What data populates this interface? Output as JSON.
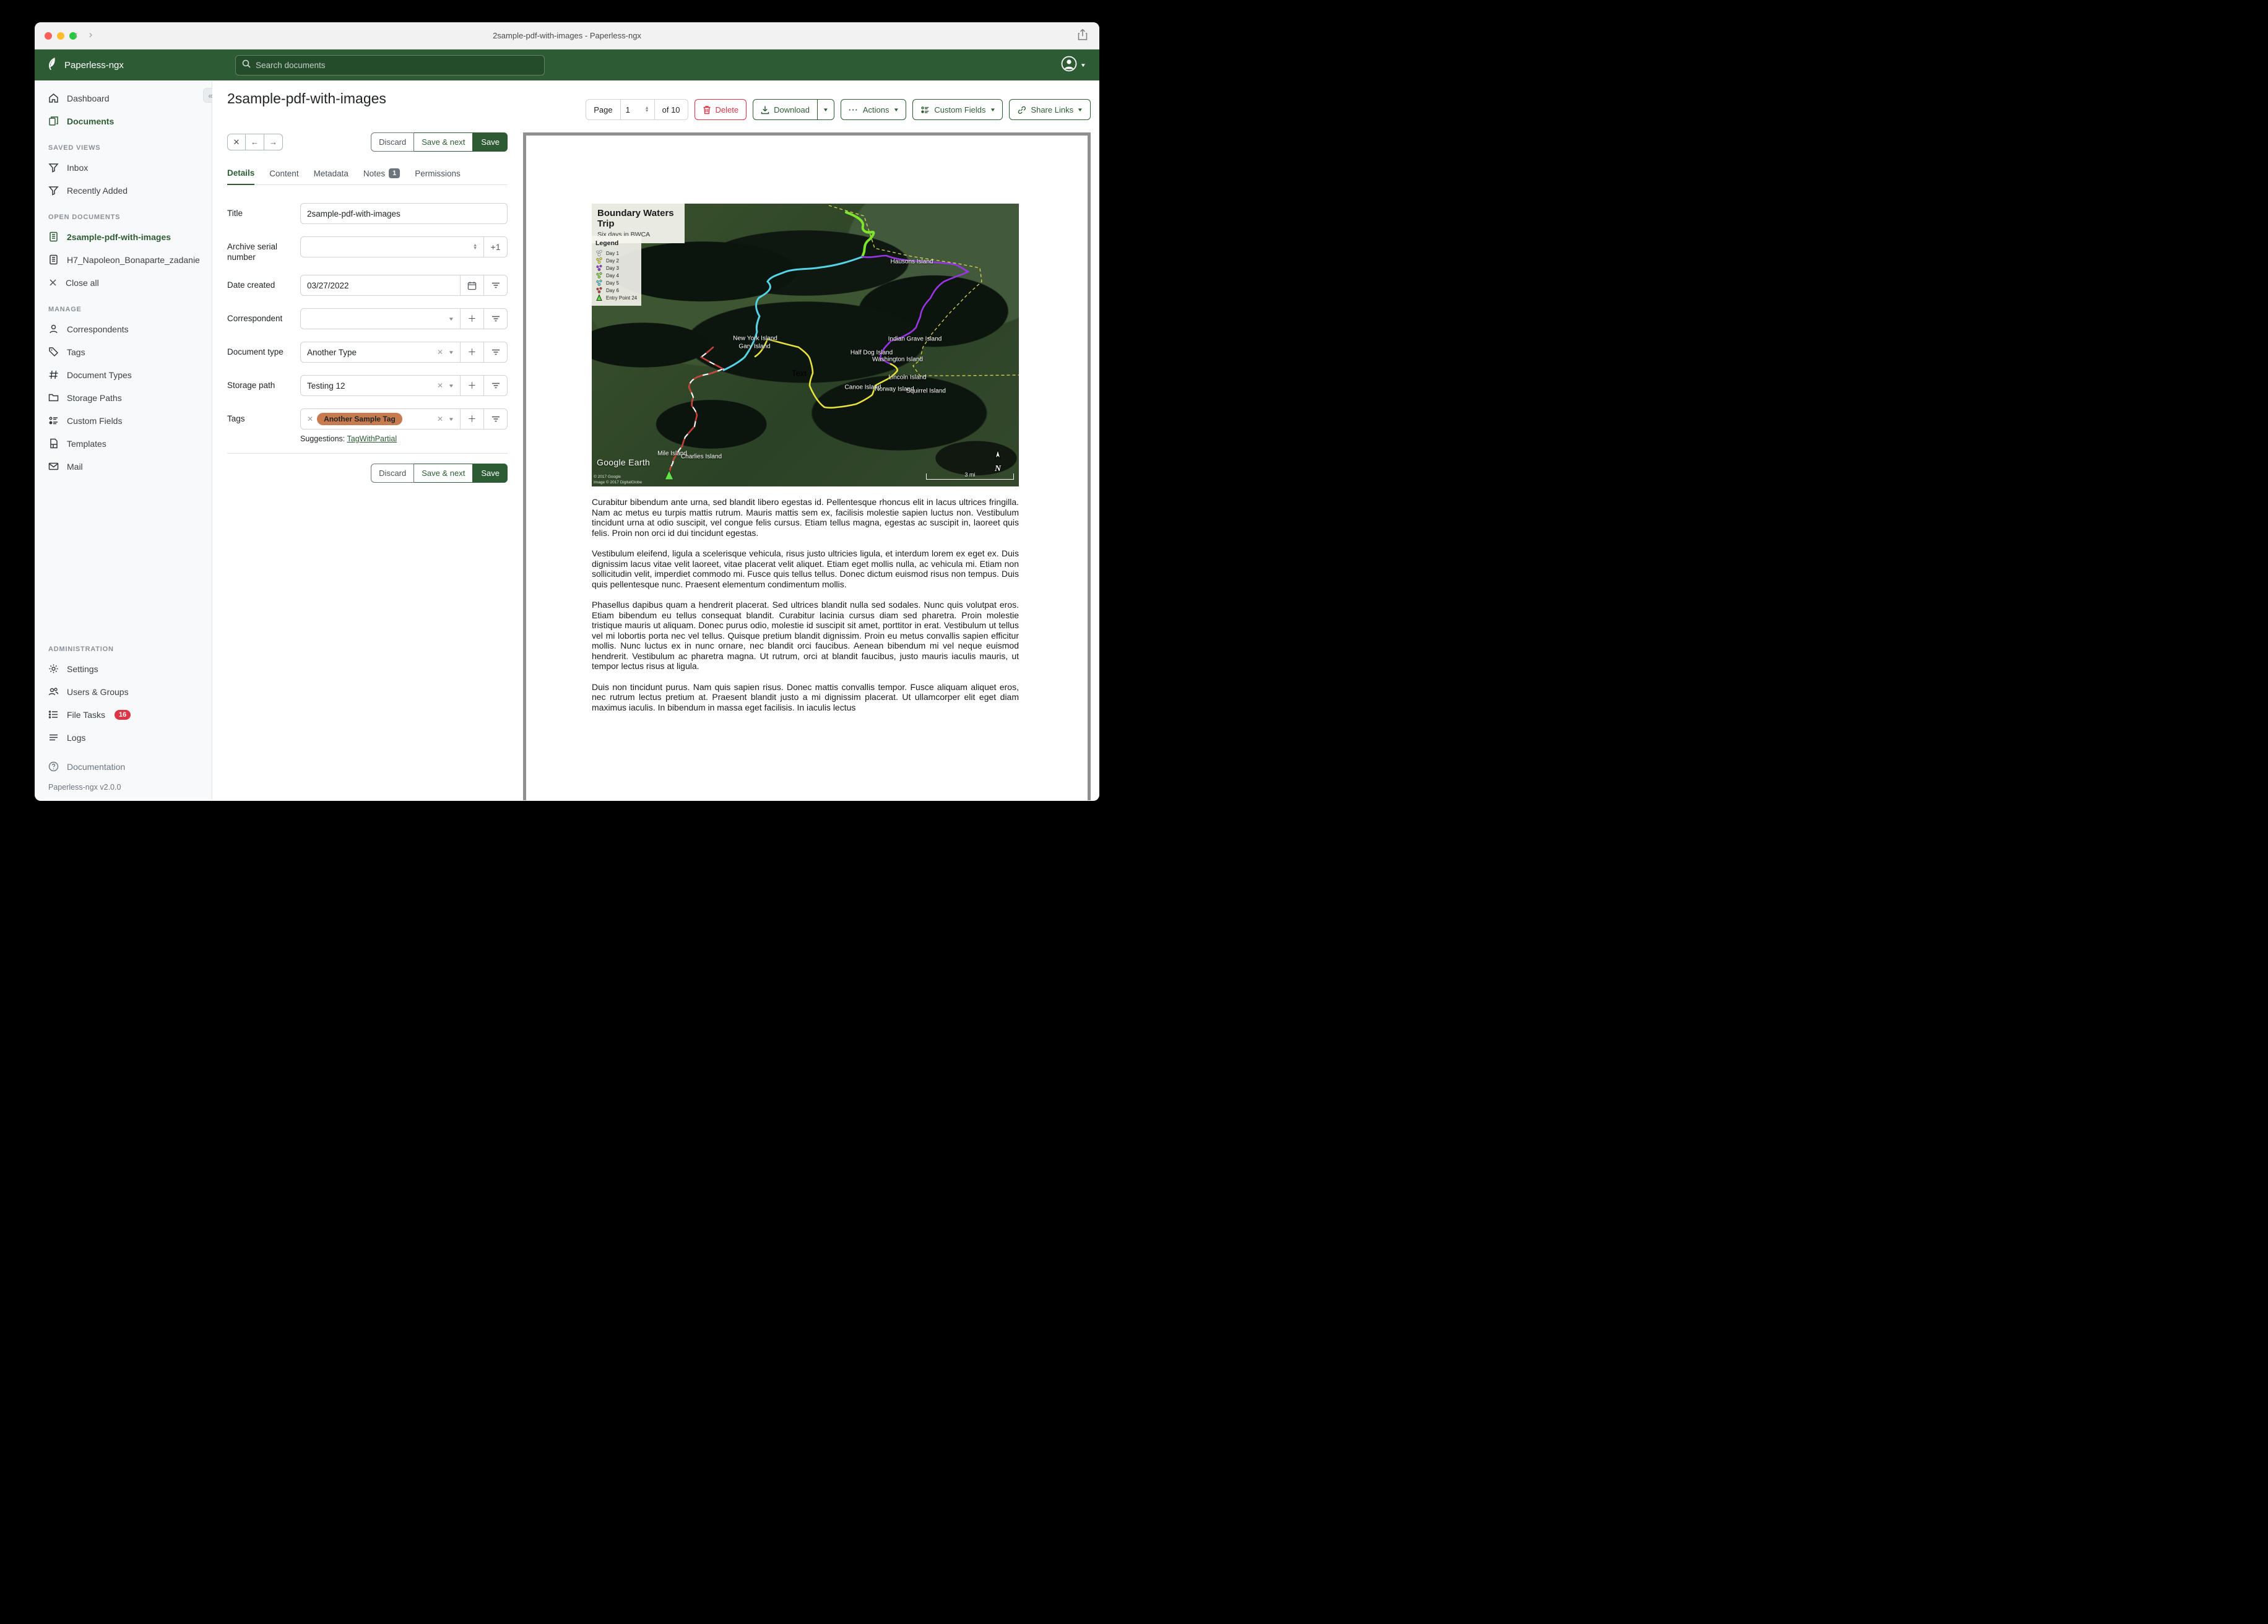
{
  "window": {
    "title": "2sample-pdf-with-images - Paperless-ngx"
  },
  "header": {
    "app_name": "Paperless-ngx",
    "search_placeholder": "Search documents"
  },
  "sidebar": {
    "collapse": "«",
    "items_top": [
      {
        "label": "Dashboard"
      },
      {
        "label": "Documents"
      }
    ],
    "sections": [
      {
        "title": "SAVED VIEWS",
        "items": [
          {
            "label": "Inbox"
          },
          {
            "label": "Recently Added"
          }
        ]
      },
      {
        "title": "OPEN DOCUMENTS",
        "items": [
          {
            "label": "2sample-pdf-with-images"
          },
          {
            "label": "H7_Napoleon_Bonaparte_zadanie"
          },
          {
            "label": "Close all"
          }
        ]
      },
      {
        "title": "MANAGE",
        "items": [
          {
            "label": "Correspondents"
          },
          {
            "label": "Tags"
          },
          {
            "label": "Document Types"
          },
          {
            "label": "Storage Paths"
          },
          {
            "label": "Custom Fields"
          },
          {
            "label": "Templates"
          },
          {
            "label": "Mail"
          }
        ]
      },
      {
        "title": "ADMINISTRATION",
        "items": [
          {
            "label": "Settings"
          },
          {
            "label": "Users & Groups"
          },
          {
            "label": "File Tasks",
            "badge": "16"
          },
          {
            "label": "Logs"
          }
        ]
      }
    ],
    "documentation": "Documentation",
    "version": "Paperless-ngx v2.0.0"
  },
  "toolbar": {
    "page_label": "Page",
    "page_value": "1",
    "page_total": "of 10",
    "delete": "Delete",
    "download": "Download",
    "actions": "Actions",
    "custom_fields": "Custom Fields",
    "share_links": "Share Links"
  },
  "editor": {
    "title": "2sample-pdf-with-images",
    "discard": "Discard",
    "save_next": "Save & next",
    "save": "Save",
    "tabs": [
      {
        "label": "Details"
      },
      {
        "label": "Content"
      },
      {
        "label": "Metadata"
      },
      {
        "label": "Notes",
        "badge": "1"
      },
      {
        "label": "Permissions"
      }
    ],
    "fields": {
      "title": {
        "label": "Title",
        "value": "2sample-pdf-with-images"
      },
      "asn": {
        "label": "Archive serial number",
        "value": "",
        "increment": "+1"
      },
      "date_created": {
        "label": "Date created",
        "value": "03/27/2022"
      },
      "correspondent": {
        "label": "Correspondent",
        "value": ""
      },
      "document_type": {
        "label": "Document type",
        "value": "Another Type"
      },
      "storage_path": {
        "label": "Storage path",
        "value": "Testing 12"
      },
      "tags": {
        "label": "Tags",
        "chips": [
          {
            "label": "Another Sample Tag",
            "color": "#c77b4f"
          }
        ]
      },
      "suggestions": {
        "label": "Suggestions:",
        "links": [
          {
            "label": "TagWithPartial"
          }
        ]
      }
    }
  },
  "preview": {
    "map": {
      "title": "Boundary Waters Trip",
      "subtitle": "Six days in BWCA",
      "legend": {
        "title": "Legend",
        "items": [
          {
            "label": "Day 1",
            "color": "#eef8fa"
          },
          {
            "label": "Day 2",
            "color": "#e6e23c"
          },
          {
            "label": "Day 3",
            "color": "#9a35e8"
          },
          {
            "label": "Day 4",
            "color": "#7fe42c"
          },
          {
            "label": "Day 5",
            "color": "#54d4e6"
          },
          {
            "label": "Day 6",
            "color": "#cf3a30"
          },
          {
            "label": "Entry Point 24",
            "color": "#63e04a"
          }
        ]
      },
      "routes": {
        "day1": "#ffffff",
        "day2": "#e8e23c",
        "day3": "#9a35e8",
        "day4": "#7fe42c",
        "day5": "#54d4e6",
        "day6": "#d03a30",
        "boundary": "#d8d855",
        "entry": "#63e04a"
      },
      "labels": [
        "Hausons Island",
        "New York Island",
        "Gary Island",
        "Indian Grave Island",
        "Half Dog Island",
        "Washington Island",
        "Lincoln Island",
        "Canoe Island",
        "Norway Island",
        "Squirrel Island",
        "Mile Island",
        "Charlies Island"
      ],
      "text_annotation": "Text",
      "attribution": {
        "logo": "Google Earth",
        "line1": "© 2017 Google",
        "line2": "Image © 2017 DigitalGlobe"
      },
      "compass": "N",
      "scale": "3 mi"
    },
    "paragraphs": [
      "Curabitur bibendum ante urna, sed blandit libero egestas id. Pellentesque rhoncus elit in lacus ultrices fringilla. Nam ac metus eu turpis mattis rutrum. Mauris mattis sem ex, facilisis molestie sapien luctus non. Vestibulum tincidunt urna at odio suscipit, vel congue felis cursus. Etiam tellus magna, egestas ac suscipit in, laoreet quis felis. Proin non orci id dui tincidunt egestas.",
      "Vestibulum eleifend, ligula a scelerisque vehicula, risus justo ultricies ligula, et interdum lorem ex eget ex. Duis dignissim lacus vitae velit laoreet, vitae placerat velit aliquet. Etiam eget mollis nulla, ac vehicula mi. Etiam non sollicitudin velit, imperdiet commodo mi. Fusce quis tellus tellus. Donec dictum euismod risus non tempus. Duis quis pellentesque nunc. Praesent elementum condimentum mollis.",
      "Phasellus dapibus quam a hendrerit placerat. Sed ultrices blandit nulla sed sodales. Nunc quis volutpat eros. Etiam bibendum eu tellus consequat blandit. Curabitur lacinia cursus diam sed pharetra. Proin molestie tristique mauris ut aliquam. Donec purus odio, molestie id suscipit sit amet, porttitor in erat. Vestibulum ut tellus vel mi lobortis porta nec vel tellus. Quisque pretium blandit dignissim. Proin eu metus convallis sapien efficitur mollis. Nunc luctus ex in nunc ornare, nec blandit orci faucibus. Aenean bibendum mi vel neque euismod hendrerit. Vestibulum ac pharetra magna. Ut rutrum, orci at blandit faucibus, justo mauris iaculis mauris, ut tempor lectus risus at ligula.",
      "Duis non tincidunt purus. Nam quis sapien risus. Donec mattis convallis tempor. Fusce aliquam aliquet eros, nec rutrum lectus pretium at. Praesent blandit justo a mi dignissim placerat. Ut ullamcorper elit eget diam maximus iaculis. In bibendum in massa eget facilisis. In iaculis lectus"
    ]
  }
}
